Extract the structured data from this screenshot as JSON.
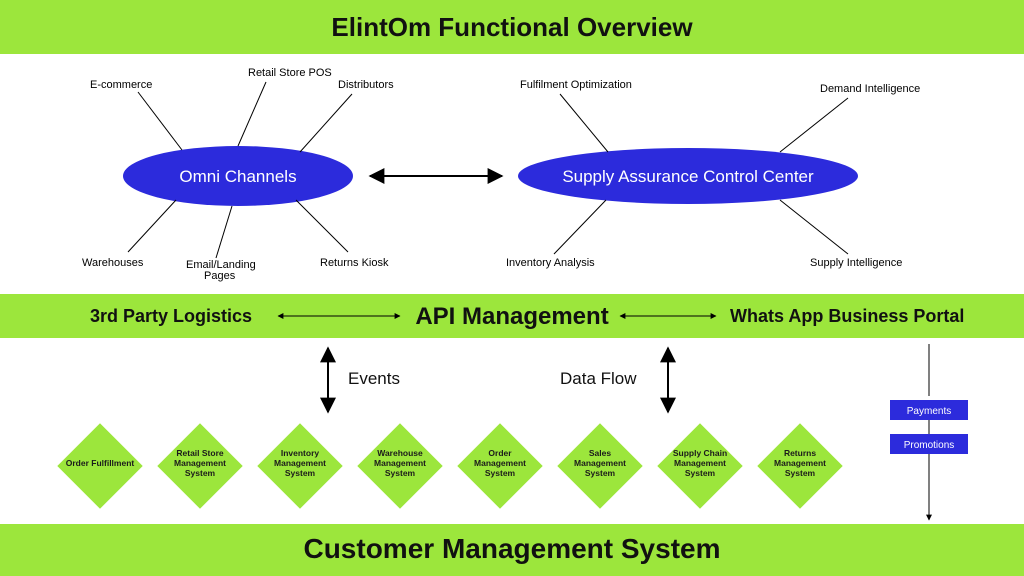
{
  "banners": {
    "top_title": "ElintOm Functional Overview",
    "bottom_title": "Customer Management System"
  },
  "hubs": {
    "left": {
      "label": "Omni Channels",
      "spokes": [
        "E-commerce",
        "Retail Store POS",
        "Distributors",
        "Warehouses",
        "Email/Landing Pages",
        "Returns Kiosk"
      ]
    },
    "right": {
      "label": "Supply Assurance Control Center",
      "spokes": [
        "Fulfilment  Optimization",
        "Demand  Intelligence",
        "Inventory  Analysis",
        "Supply  Intelligence"
      ]
    }
  },
  "api_row": {
    "left": "3rd Party  Logistics",
    "center": "API Management",
    "right": "Whats App Business Portal"
  },
  "flow_labels": {
    "events": "Events",
    "dataflow": "Data Flow"
  },
  "systems": [
    "Order Fulfillment",
    "Retail Store Management System",
    "Inventory Management System",
    "Warehouse Management System",
    "Order Management System",
    "Sales Management System",
    "Supply Chain Management System",
    "Returns Management System"
  ],
  "side_tags": [
    "Payments",
    "Promotions"
  ]
}
